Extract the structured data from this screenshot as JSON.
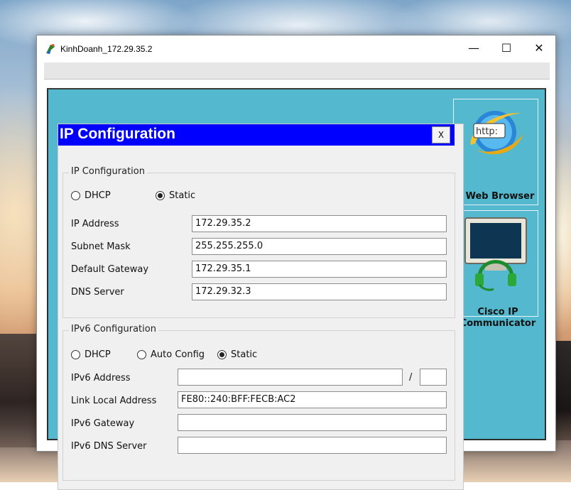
{
  "window": {
    "title": "KinhDoanh_172.29.35.2",
    "minimize_glyph": "—",
    "maximize_glyph": "☐",
    "close_glyph": "✕"
  },
  "desktop_apps": {
    "web_browser": {
      "label": "Web Browser",
      "icon": "web-browser-icon",
      "icon_text": "http:"
    },
    "cisco_ip_communicator": {
      "label": "Cisco IP Communicator",
      "icon": "cisco-ip-communicator-icon"
    }
  },
  "dialog": {
    "title": "IP Configuration",
    "close_label": "X",
    "ipv4": {
      "group_title": "IP Configuration",
      "mode_options": [
        {
          "label": "DHCP",
          "selected": false
        },
        {
          "label": "Static",
          "selected": true
        }
      ],
      "fields": {
        "ip_address": {
          "label": "IP Address",
          "value": "172.29.35.2"
        },
        "subnet_mask": {
          "label": "Subnet Mask",
          "value": "255.255.255.0"
        },
        "default_gateway": {
          "label": "Default Gateway",
          "value": "172.29.35.1"
        },
        "dns_server": {
          "label": "DNS Server",
          "value": "172.29.32.3"
        }
      }
    },
    "ipv6": {
      "group_title": "IPv6 Configuration",
      "mode_options": [
        {
          "label": "DHCP",
          "selected": false
        },
        {
          "label": "Auto Config",
          "selected": false
        },
        {
          "label": "Static",
          "selected": true
        }
      ],
      "prefix_separator": "/",
      "fields": {
        "ipv6_address": {
          "label": "IPv6 Address",
          "value": "",
          "prefix_value": ""
        },
        "link_local_address": {
          "label": "Link Local Address",
          "value": "FE80::240:BFF:FECB:AC2"
        },
        "ipv6_gateway": {
          "label": "IPv6 Gateway",
          "value": ""
        },
        "ipv6_dns_server": {
          "label": "IPv6 DNS Server",
          "value": ""
        }
      }
    }
  },
  "colors": {
    "dialog_header": "#0000ff",
    "desktop_panel": "#54b8cf",
    "dialog_background": "#f0f0f0"
  }
}
